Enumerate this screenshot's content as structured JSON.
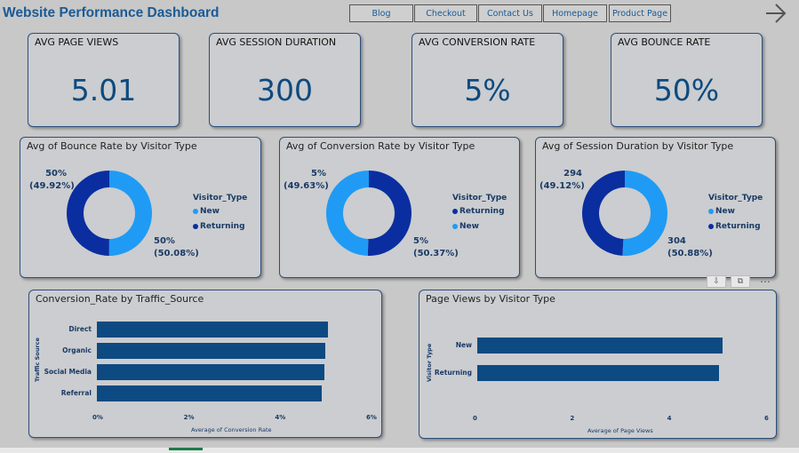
{
  "header": {
    "title": "Website Performance Dashboard",
    "nav": [
      "Blog",
      "Checkout",
      "Contact Us",
      "Homepage",
      "Product Page"
    ],
    "next_icon": "arrow-right-icon"
  },
  "kpis": [
    {
      "label": "AVG PAGE VIEWS",
      "value": "5.01"
    },
    {
      "label": "AVG SESSION DURATION",
      "value": "300"
    },
    {
      "label": "AVG CONVERSION RATE",
      "value": "5%"
    },
    {
      "label": "AVG BOUNCE RATE",
      "value": "50%"
    }
  ],
  "donuts": [
    {
      "title": "Avg of Bounce Rate by Visitor Type",
      "legend_title": "Visitor_Type",
      "legend": [
        {
          "name": "New",
          "color": "#1f9bf5"
        },
        {
          "name": "Returning",
          "color": "#0a2ea0"
        }
      ],
      "label_top": [
        "50%",
        "(49.92%)"
      ],
      "label_bottom": [
        "50%",
        "(50.08%)"
      ],
      "slices": [
        {
          "name": "Returning",
          "value": 49.92,
          "color": "#0a2ea0"
        },
        {
          "name": "New",
          "value": 50.08,
          "color": "#1f9bf5"
        }
      ]
    },
    {
      "title": "Avg of Conversion Rate by Visitor Type",
      "legend_title": "Visitor_Type",
      "legend": [
        {
          "name": "Returning",
          "color": "#0a2ea0"
        },
        {
          "name": "New",
          "color": "#1f9bf5"
        }
      ],
      "label_top": [
        "5%",
        "(49.63%)"
      ],
      "label_bottom": [
        "5%",
        "(50.37%)"
      ],
      "slices": [
        {
          "name": "New",
          "value": 49.63,
          "color": "#1f9bf5"
        },
        {
          "name": "Returning",
          "value": 50.37,
          "color": "#0a2ea0"
        }
      ]
    },
    {
      "title": "Avg of Session Duration by Visitor Type",
      "legend_title": "Visitor_Type",
      "legend": [
        {
          "name": "New",
          "color": "#1f9bf5"
        },
        {
          "name": "Returning",
          "color": "#0a2ea0"
        }
      ],
      "label_top": [
        "294",
        "(49.12%)"
      ],
      "label_bottom": [
        "304",
        "(50.88%)"
      ],
      "slices": [
        {
          "name": "Returning",
          "value": 49.12,
          "color": "#0a2ea0"
        },
        {
          "name": "New",
          "value": 50.88,
          "color": "#1f9bf5"
        }
      ]
    }
  ],
  "bar1": {
    "title": "Conversion_Rate by Traffic_Source",
    "ylabel": "Traffic Source",
    "xlabel": "Average of Conversion Rate",
    "ticks": [
      "0%",
      "2%",
      "4%",
      "6%"
    ],
    "xmax": 6,
    "categories": [
      "Direct",
      "Organic",
      "Social Media",
      "Referral"
    ],
    "values": [
      5.07,
      5.01,
      4.98,
      4.92
    ]
  },
  "bar2": {
    "title": "Page Views by Visitor Type",
    "ylabel": "Visitor Type",
    "xlabel": "Average of Page Views",
    "ticks": [
      "0",
      "2",
      "4",
      "6"
    ],
    "xmax": 6,
    "categories": [
      "New",
      "Returning"
    ],
    "values": [
      5.04,
      4.97
    ]
  },
  "chart_data": [
    {
      "type": "bar",
      "title": "Conversion_Rate by Traffic_Source",
      "categories": [
        "Direct",
        "Organic",
        "Social Media",
        "Referral"
      ],
      "values": [
        5.07,
        5.01,
        4.98,
        4.92
      ],
      "xlabel": "Average of Conversion Rate",
      "ylabel": "Traffic Source",
      "xlim": [
        0,
        6
      ]
    },
    {
      "type": "bar",
      "title": "Page Views by Visitor Type",
      "categories": [
        "New",
        "Returning"
      ],
      "values": [
        5.04,
        4.97
      ],
      "xlabel": "Average of Page Views",
      "ylabel": "Visitor Type",
      "xlim": [
        0,
        6
      ]
    }
  ]
}
